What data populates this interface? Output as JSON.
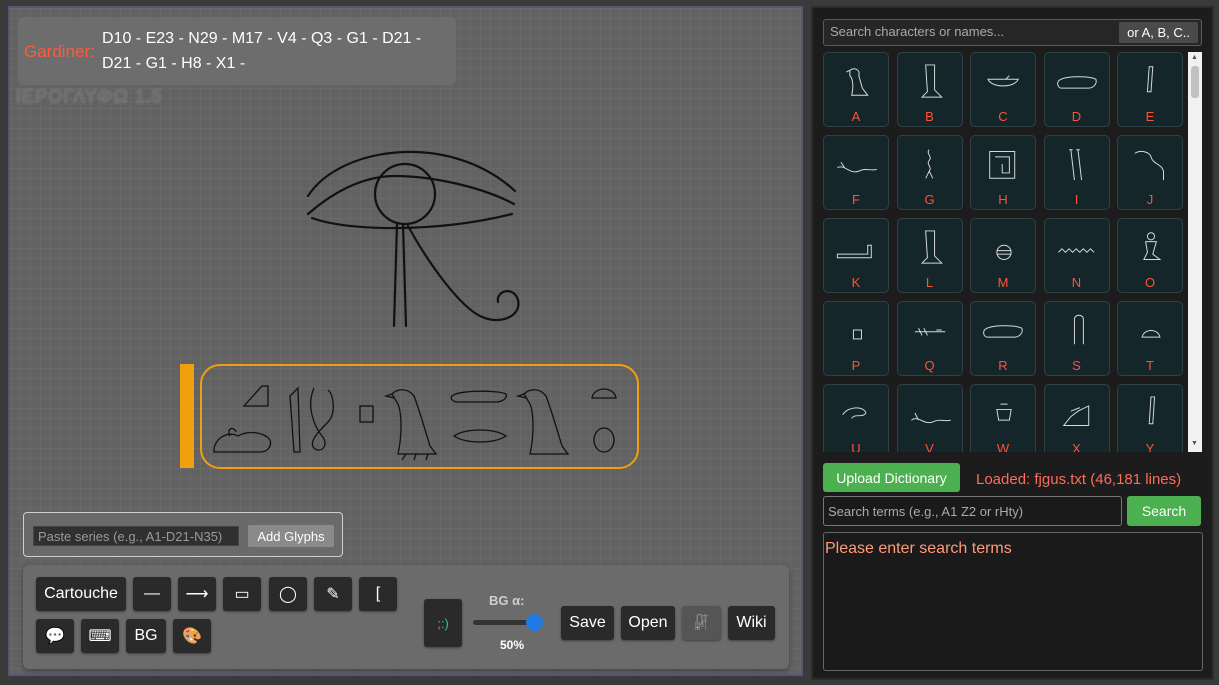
{
  "gardiner": {
    "label": "Gardiner:",
    "codes": "D10 - E23 - N29 - M17 - V4 - Q3 - G1 - D21 - D21 - G1 - H8 - X1 -"
  },
  "app_title": "ΙΕΡΟΓΛΥΦΩ 1.5",
  "paste": {
    "placeholder": "Paste series (e.g., A1-D21-N35)",
    "add_label": "Add Glyphs"
  },
  "toolbar": {
    "cartouche": "Cartouche",
    "line": "—",
    "arrow": "⟶",
    "rect": "▭",
    "circle": "◯",
    "pencil": "✎",
    "bracket": "[",
    "comment": "💬",
    "keyboard": "⌨",
    "bg": "BG",
    "palette": "🎨",
    "emoji": ";:)",
    "bg_alpha_label": "BG α:",
    "bg_alpha_value": "50%",
    "bg_alpha_level": 0.5,
    "save": "Save",
    "open": "Open",
    "glyph_icon": "𓏞",
    "wiki": "Wiki"
  },
  "panel": {
    "search_placeholder": "Search characters or names...",
    "abc_button": "or A, B, C..",
    "categories": [
      "A",
      "B",
      "C",
      "D",
      "E",
      "F",
      "G",
      "H",
      "I",
      "J",
      "K",
      "L",
      "M",
      "N",
      "O",
      "P",
      "Q",
      "R",
      "S",
      "T",
      "U",
      "V",
      "W",
      "X",
      "Y"
    ],
    "upload_label": "Upload Dictionary",
    "loaded_text": "Loaded: fjgus.txt (46,181 lines)",
    "terms_placeholder": "Search terms (e.g., A1 Z2 or rHty)",
    "search_label": "Search",
    "results_text": "Please enter search terms"
  },
  "colors": {
    "accent_orange": "#f0a00c",
    "gardiner_red": "#ff5b3c",
    "green": "#4caf50"
  }
}
